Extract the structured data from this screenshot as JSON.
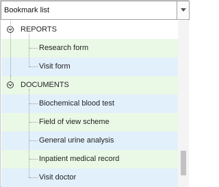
{
  "header": {
    "title": "Bookmark list"
  },
  "tree": {
    "groups": [
      {
        "label": "REPORTS",
        "expanded": true,
        "children": [
          {
            "label": "Research form"
          },
          {
            "label": "Visit form"
          }
        ]
      },
      {
        "label": "DOCUMENTS",
        "expanded": true,
        "children": [
          {
            "label": "Biochemical blood test"
          },
          {
            "label": "Field of view scheme"
          },
          {
            "label": "General urine analysis"
          },
          {
            "label": "Inpatient medical record"
          },
          {
            "label": "Visit doctor"
          }
        ]
      }
    ]
  },
  "colors": {
    "row_green": "#eaf8e6",
    "row_blue": "#e2f0fb",
    "connector": "#9a9a9a"
  },
  "icons": {
    "expander": "collapse-arrow-circle-icon",
    "dropdown": "chevron-down-icon"
  }
}
